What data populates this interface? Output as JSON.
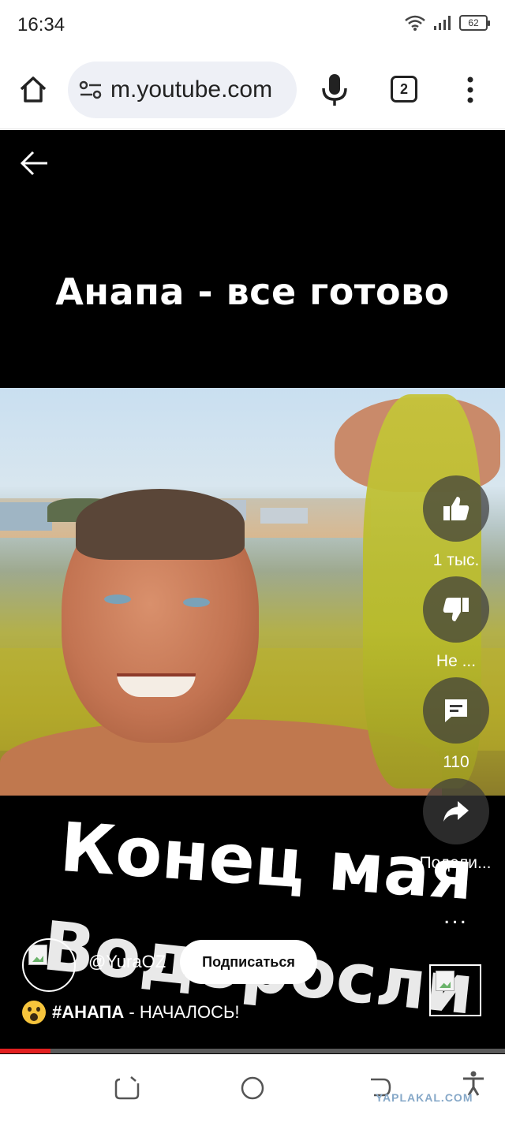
{
  "status_bar": {
    "time": "16:34",
    "battery": "62"
  },
  "browser": {
    "url": "m.youtube.com",
    "tab_count": "2"
  },
  "video": {
    "top_caption": "Анапа - все готово",
    "overlay_line1": "Конец мая",
    "overlay_line2": "Водоросли",
    "channel_handle": "@YuraOZ",
    "subscribe_label": "Подписаться",
    "title_hashtag": "#АНАПА",
    "title_rest": " - НАЧАЛОСЬ!",
    "progress": 0.1
  },
  "actions": {
    "like_count": "1 тыс.",
    "dislike_label": "Не ...",
    "comment_count": "110",
    "share_label": "Подели...",
    "more_label": "..."
  },
  "watermark": "YAPLAKAL.COM",
  "colors": {
    "progress": "#e32020",
    "subscribe_bg": "#ffffff",
    "background": "#000000"
  }
}
